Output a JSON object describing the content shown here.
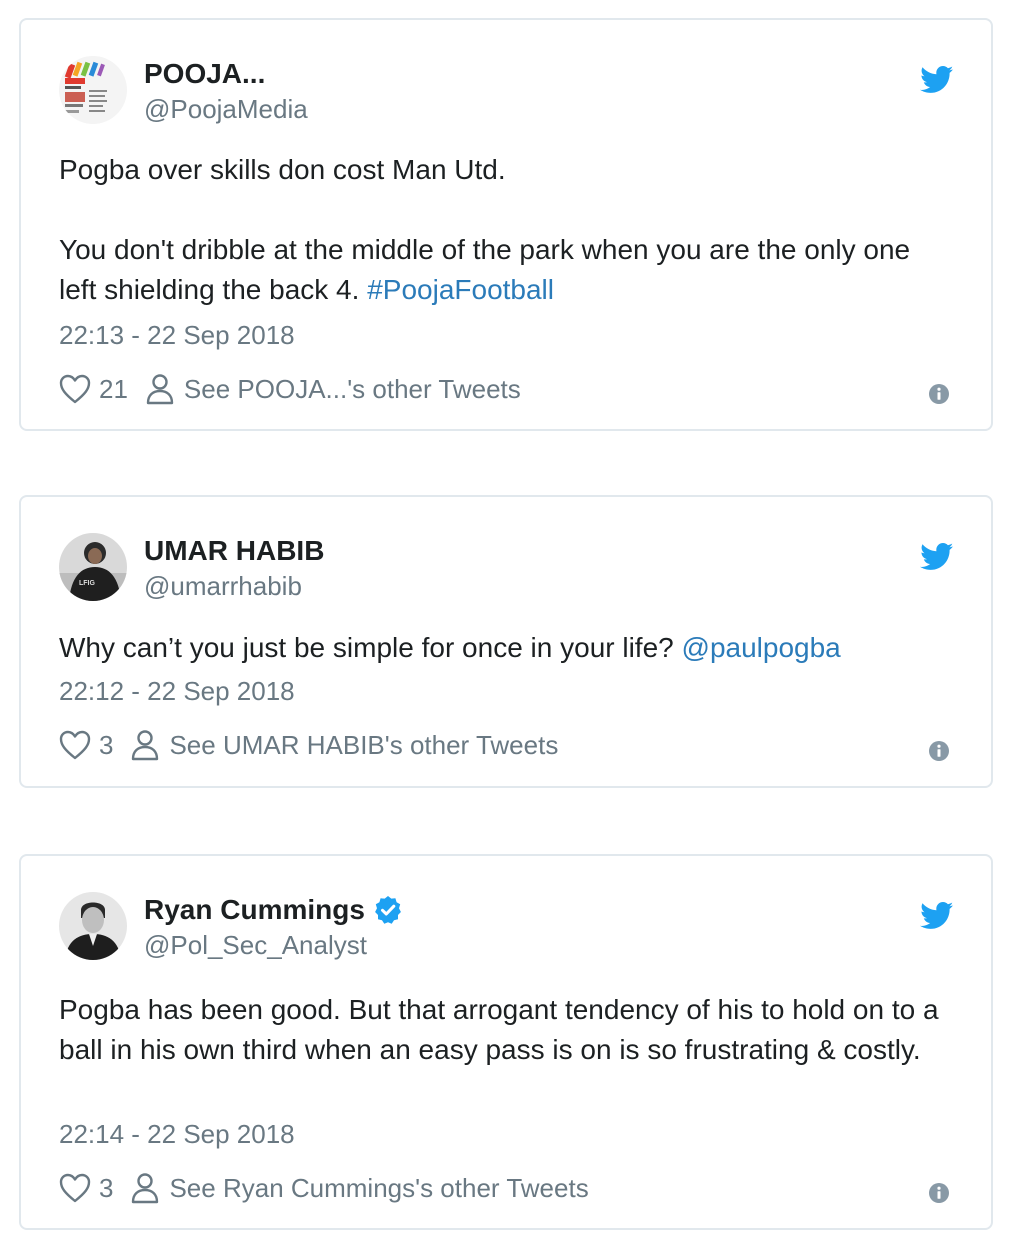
{
  "tweets": [
    {
      "name": "POOJA...",
      "handle": "@PoojaMedia",
      "verified": false,
      "body_1": "Pogba over skills don cost Man Utd.",
      "body_2": "You don't dribble at the middle of the park when you are the only one left shielding the back 4.",
      "hashtag": "#PoojaFootball",
      "time": "22:13 - 22 Sep 2018",
      "likes": "21",
      "other_tweets": "See POOJA...'s other Tweets"
    },
    {
      "name": "UMAR HABIB",
      "handle": "@umarrhabib",
      "verified": false,
      "body_1": "Why can’t you just be simple for once in your life?",
      "mention": "@paulpogba",
      "time": "22:12 - 22 Sep 2018",
      "likes": "3",
      "other_tweets": "See UMAR HABIB's other Tweets"
    },
    {
      "name": "Ryan Cummings",
      "handle": "@Pol_Sec_Analyst",
      "verified": true,
      "body_1": "Pogba has been good. But that arrogant tendency of his to hold on to a ball in his own third when an easy pass is on is so frustrating & costly.",
      "time": "22:14 - 22 Sep 2018",
      "likes": "3",
      "other_tweets": "See Ryan Cummings's other Tweets"
    }
  ],
  "colors": {
    "text": "#1c2022",
    "muted": "#697882",
    "link": "#2b7bb9",
    "twitter_blue": "#1da1f2",
    "border": "#e1e8ed"
  },
  "icons": [
    "twitter-bird-icon",
    "heart-icon",
    "person-icon",
    "info-icon",
    "verified-badge-icon"
  ]
}
